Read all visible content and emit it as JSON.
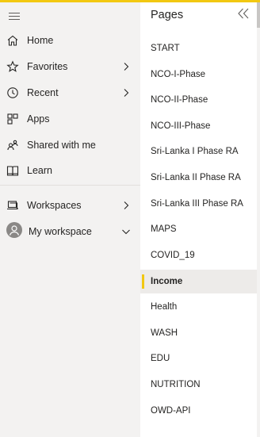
{
  "nav": {
    "items": [
      {
        "label": "Home",
        "icon": "home-icon",
        "chevron": false
      },
      {
        "label": "Favorites",
        "icon": "star-icon",
        "chevron": true
      },
      {
        "label": "Recent",
        "icon": "clock-icon",
        "chevron": true
      },
      {
        "label": "Apps",
        "icon": "apps-icon",
        "chevron": false
      },
      {
        "label": "Shared with me",
        "icon": "shared-icon",
        "chevron": false
      },
      {
        "label": "Learn",
        "icon": "book-icon",
        "chevron": false
      }
    ],
    "workspaces_label": "Workspaces",
    "my_workspace_label": "My workspace"
  },
  "pages": {
    "title": "Pages",
    "items": [
      "START",
      "NCO-I-Phase",
      "NCO-II-Phase",
      "NCO-III-Phase",
      "Sri-Lanka I Phase RA",
      "Sri-Lanka II Phase RA",
      "Sri-Lanka III Phase RA",
      "MAPS",
      "COVID_19",
      "Income",
      "Health",
      "WASH",
      "EDU",
      "NUTRITION",
      "OWD-API"
    ],
    "active": "Income"
  },
  "colors": {
    "accent": "#f2c811",
    "nav_bg": "#f3f2f1",
    "active_bg": "#edebe9",
    "text": "#252423"
  }
}
